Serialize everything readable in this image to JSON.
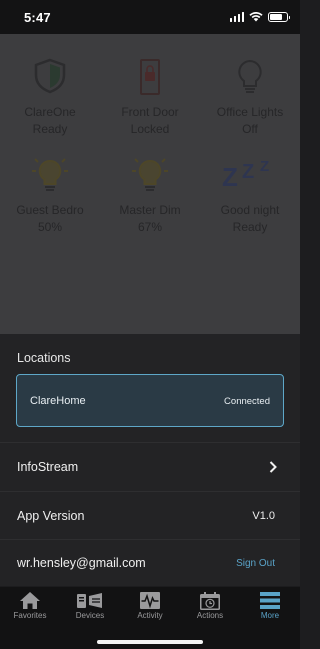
{
  "status_bar": {
    "time": "5:47",
    "battery_level": 0.75
  },
  "home_tiles": [
    {
      "name": "ClareOne",
      "status": "Ready",
      "icon": "shield-icon"
    },
    {
      "name": "Front Door",
      "status": "Locked",
      "icon": "door-lock-icon"
    },
    {
      "name": "Office Lights",
      "status": "Off",
      "icon": "lightbulb-icon"
    },
    {
      "name": "Guest Bedro",
      "status": "50%",
      "icon": "lightbulb-icon"
    },
    {
      "name": "Master Dim",
      "status": "67%",
      "icon": "lightbulb-icon"
    },
    {
      "name": "Good night",
      "status": "Ready",
      "icon": "sleep-icon"
    }
  ],
  "settings": {
    "locations_title": "Locations",
    "location": {
      "name": "ClareHome",
      "status": "Connected"
    },
    "infostream_label": "InfoStream",
    "app_version_label": "App Version",
    "app_version_value": "V1.0",
    "account_email": "wr.hensley@gmail.com",
    "sign_out_label": "Sign Out"
  },
  "tabs": [
    {
      "label": "Favorites",
      "icon": "home-icon"
    },
    {
      "label": "Devices",
      "icon": "devices-icon"
    },
    {
      "label": "Activity",
      "icon": "activity-icon"
    },
    {
      "label": "Actions",
      "icon": "calendar-clock-icon"
    },
    {
      "label": "More",
      "icon": "menu-icon",
      "active": true
    }
  ],
  "colors": {
    "accent": "#5aa3c8",
    "location_card_bg": "#2a3a45",
    "overlay_bg": "#3d3d3f",
    "sheet_bg": "#232325",
    "tab_bar_bg": "#121213"
  }
}
